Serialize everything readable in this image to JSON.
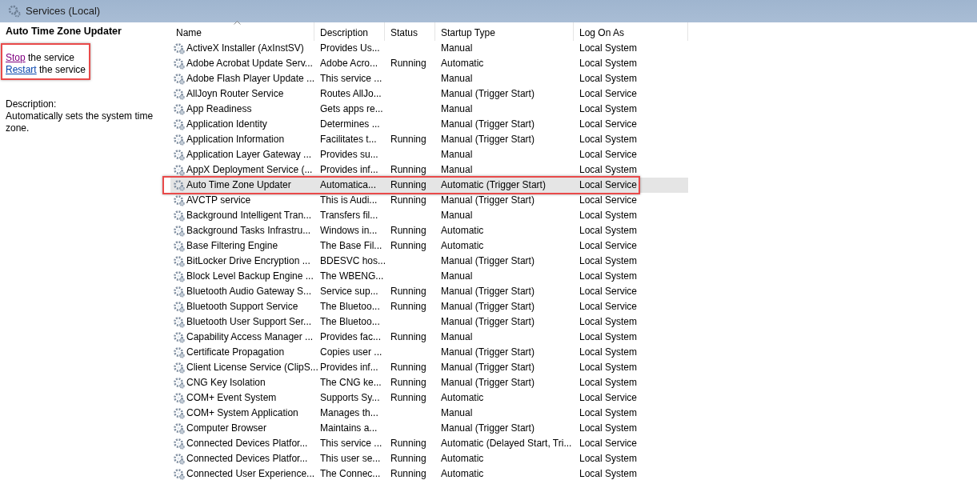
{
  "window": {
    "title": "Services (Local)"
  },
  "details": {
    "service_name": "Auto Time Zone Updater",
    "actions": [
      {
        "link": "Stop",
        "text": " the service",
        "visited": true
      },
      {
        "link": "Restart",
        "text": " the service",
        "visited": false
      }
    ],
    "actions_annotated": true,
    "description_label": "Description:",
    "description": "Automatically sets the system time zone."
  },
  "table": {
    "columns": [
      {
        "label": "Name",
        "sorted": true
      },
      {
        "label": "Description",
        "sorted": false
      },
      {
        "label": "Status",
        "sorted": false
      },
      {
        "label": "Startup Type",
        "sorted": false
      },
      {
        "label": "Log On As",
        "sorted": false
      }
    ],
    "rows": [
      {
        "name": "ActiveX Installer (AxInstSV)",
        "description": "Provides Us...",
        "status": "",
        "startup_type": "Manual",
        "log_on_as": "Local System",
        "selected": false,
        "annotated": false
      },
      {
        "name": "Adobe Acrobat Update Serv...",
        "description": "Adobe Acro...",
        "status": "Running",
        "startup_type": "Automatic",
        "log_on_as": "Local System",
        "selected": false,
        "annotated": false
      },
      {
        "name": "Adobe Flash Player Update ...",
        "description": "This service ...",
        "status": "",
        "startup_type": "Manual",
        "log_on_as": "Local System",
        "selected": false,
        "annotated": false
      },
      {
        "name": "AllJoyn Router Service",
        "description": "Routes AllJo...",
        "status": "",
        "startup_type": "Manual (Trigger Start)",
        "log_on_as": "Local Service",
        "selected": false,
        "annotated": false
      },
      {
        "name": "App Readiness",
        "description": "Gets apps re...",
        "status": "",
        "startup_type": "Manual",
        "log_on_as": "Local System",
        "selected": false,
        "annotated": false
      },
      {
        "name": "Application Identity",
        "description": "Determines ...",
        "status": "",
        "startup_type": "Manual (Trigger Start)",
        "log_on_as": "Local Service",
        "selected": false,
        "annotated": false
      },
      {
        "name": "Application Information",
        "description": "Facilitates t...",
        "status": "Running",
        "startup_type": "Manual (Trigger Start)",
        "log_on_as": "Local System",
        "selected": false,
        "annotated": false
      },
      {
        "name": "Application Layer Gateway ...",
        "description": "Provides su...",
        "status": "",
        "startup_type": "Manual",
        "log_on_as": "Local Service",
        "selected": false,
        "annotated": false
      },
      {
        "name": "AppX Deployment Service (...",
        "description": "Provides inf...",
        "status": "Running",
        "startup_type": "Manual",
        "log_on_as": "Local System",
        "selected": false,
        "annotated": false
      },
      {
        "name": "Auto Time Zone Updater",
        "description": "Automatica...",
        "status": "Running",
        "startup_type": "Automatic (Trigger Start)",
        "log_on_as": "Local Service",
        "selected": true,
        "annotated": true
      },
      {
        "name": "AVCTP service",
        "description": "This is Audi...",
        "status": "Running",
        "startup_type": "Manual (Trigger Start)",
        "log_on_as": "Local Service",
        "selected": false,
        "annotated": false
      },
      {
        "name": "Background Intelligent Tran...",
        "description": "Transfers fil...",
        "status": "",
        "startup_type": "Manual",
        "log_on_as": "Local System",
        "selected": false,
        "annotated": false
      },
      {
        "name": "Background Tasks Infrastru...",
        "description": "Windows in...",
        "status": "Running",
        "startup_type": "Automatic",
        "log_on_as": "Local System",
        "selected": false,
        "annotated": false
      },
      {
        "name": "Base Filtering Engine",
        "description": "The Base Fil...",
        "status": "Running",
        "startup_type": "Automatic",
        "log_on_as": "Local Service",
        "selected": false,
        "annotated": false
      },
      {
        "name": "BitLocker Drive Encryption ...",
        "description": "BDESVC hos...",
        "status": "",
        "startup_type": "Manual (Trigger Start)",
        "log_on_as": "Local System",
        "selected": false,
        "annotated": false
      },
      {
        "name": "Block Level Backup Engine ...",
        "description": "The WBENG...",
        "status": "",
        "startup_type": "Manual",
        "log_on_as": "Local System",
        "selected": false,
        "annotated": false
      },
      {
        "name": "Bluetooth Audio Gateway S...",
        "description": "Service sup...",
        "status": "Running",
        "startup_type": "Manual (Trigger Start)",
        "log_on_as": "Local Service",
        "selected": false,
        "annotated": false
      },
      {
        "name": "Bluetooth Support Service",
        "description": "The Bluetoo...",
        "status": "Running",
        "startup_type": "Manual (Trigger Start)",
        "log_on_as": "Local Service",
        "selected": false,
        "annotated": false
      },
      {
        "name": "Bluetooth User Support Ser...",
        "description": "The Bluetoo...",
        "status": "",
        "startup_type": "Manual (Trigger Start)",
        "log_on_as": "Local System",
        "selected": false,
        "annotated": false
      },
      {
        "name": "Capability Access Manager ...",
        "description": "Provides fac...",
        "status": "Running",
        "startup_type": "Manual",
        "log_on_as": "Local System",
        "selected": false,
        "annotated": false
      },
      {
        "name": "Certificate Propagation",
        "description": "Copies user ...",
        "status": "",
        "startup_type": "Manual (Trigger Start)",
        "log_on_as": "Local System",
        "selected": false,
        "annotated": false
      },
      {
        "name": "Client License Service (ClipS...",
        "description": "Provides inf...",
        "status": "Running",
        "startup_type": "Manual (Trigger Start)",
        "log_on_as": "Local System",
        "selected": false,
        "annotated": false
      },
      {
        "name": "CNG Key Isolation",
        "description": "The CNG ke...",
        "status": "Running",
        "startup_type": "Manual (Trigger Start)",
        "log_on_as": "Local System",
        "selected": false,
        "annotated": false
      },
      {
        "name": "COM+ Event System",
        "description": "Supports Sy...",
        "status": "Running",
        "startup_type": "Automatic",
        "log_on_as": "Local Service",
        "selected": false,
        "annotated": false
      },
      {
        "name": "COM+ System Application",
        "description": "Manages th...",
        "status": "",
        "startup_type": "Manual",
        "log_on_as": "Local System",
        "selected": false,
        "annotated": false
      },
      {
        "name": "Computer Browser",
        "description": "Maintains a...",
        "status": "",
        "startup_type": "Manual (Trigger Start)",
        "log_on_as": "Local System",
        "selected": false,
        "annotated": false
      },
      {
        "name": "Connected Devices Platfor...",
        "description": "This service ...",
        "status": "Running",
        "startup_type": "Automatic (Delayed Start, Tri...",
        "log_on_as": "Local Service",
        "selected": false,
        "annotated": false
      },
      {
        "name": "Connected Devices Platfor...",
        "description": "This user se...",
        "status": "Running",
        "startup_type": "Automatic",
        "log_on_as": "Local System",
        "selected": false,
        "annotated": false
      },
      {
        "name": "Connected User Experience...",
        "description": "The Connec...",
        "status": "Running",
        "startup_type": "Automatic",
        "log_on_as": "Local System",
        "selected": false,
        "annotated": false
      }
    ]
  }
}
